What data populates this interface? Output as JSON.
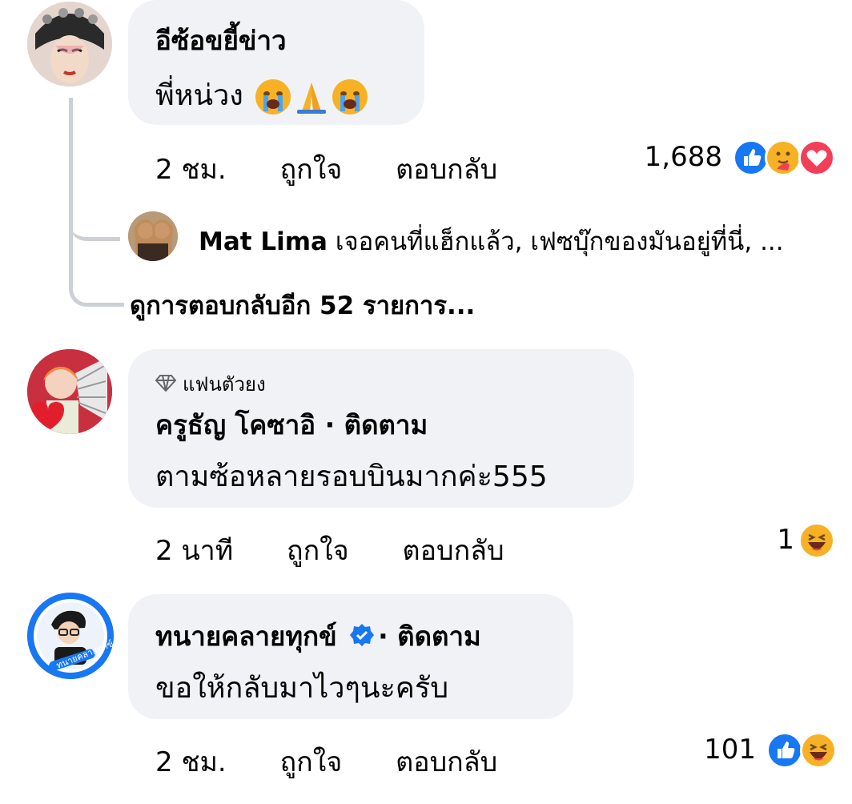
{
  "comments": [
    {
      "author": "อีซ้อขยี้ข่าว",
      "text": "พี่หน่วง",
      "text_emojis": [
        "crying-face",
        "folded-hands",
        "crying-face"
      ],
      "time": "2 ชม.",
      "like": "ถูกใจ",
      "reply": "ตอบกลับ",
      "reaction_count": "1,688",
      "reactions": [
        "like",
        "care",
        "love"
      ],
      "reply_preview": {
        "author": "Mat Lima",
        "text": "เจอคนที่แฮ็กแล้ว, เฟซบุ๊กของมันอยู่ที่นี่, ..."
      },
      "more_replies": "ดูการตอบกลับอีก 52 รายการ..."
    },
    {
      "badge": "แฟนตัวยง",
      "author": "ครูธัญ โคซาอิ",
      "follow": "· ติดตาม",
      "text": "ตามซ้อหลายรอบบินมากค่ะ555",
      "time": "2 นาที",
      "like": "ถูกใจ",
      "reply": "ตอบกลับ",
      "reaction_count": "1",
      "reactions": [
        "haha"
      ]
    },
    {
      "author": "ทนายคลายทุกข์",
      "verified": true,
      "follow": "· ติดตาม",
      "text": "ขอให้กลับมาไวๆนะครับ",
      "avatar_caption": "ทนายคลายทุกข์",
      "time": "2 ชม.",
      "like": "ถูกใจ",
      "reply": "ตอบกลับ",
      "reaction_count": "101",
      "reactions": [
        "like",
        "haha"
      ]
    }
  ],
  "colors": {
    "bubble": "#f0f2f5",
    "like_blue": "#1877f2",
    "love_red": "#f33e58",
    "haha_yellow": "#f7b125",
    "thread_line": "#ccd0d5"
  }
}
